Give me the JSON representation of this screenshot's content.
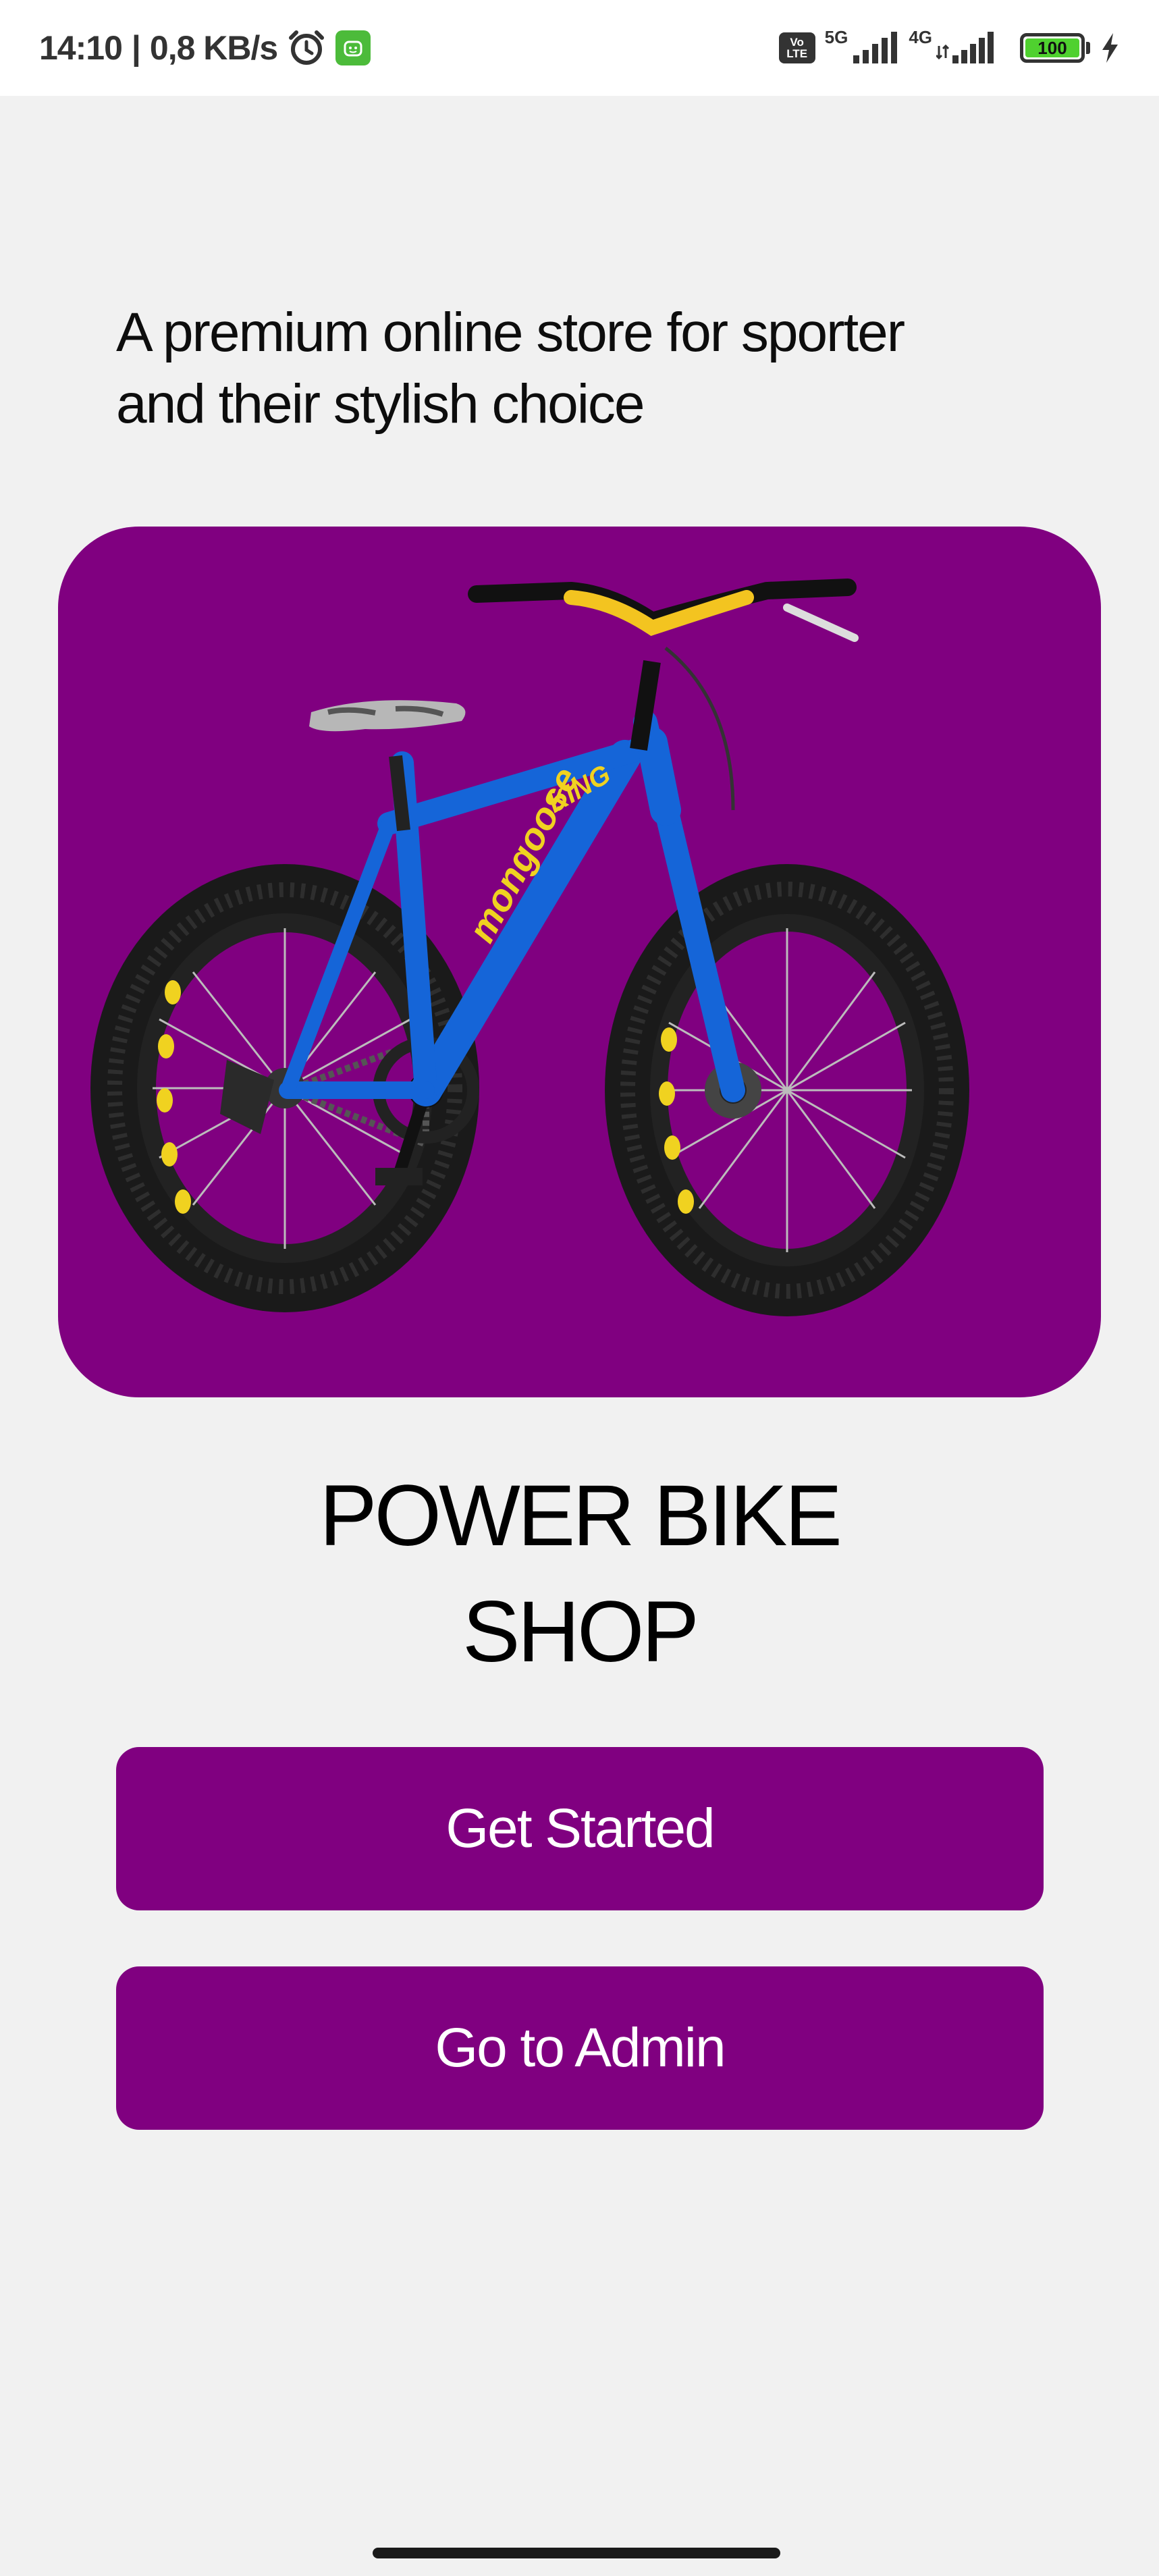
{
  "status_bar": {
    "time": "14:10",
    "separator": "|",
    "speed": "0,8 KB/s",
    "volte_line1": "Vo",
    "volte_line2": "LTE",
    "net1": "5G",
    "net2": "4G",
    "battery": "100",
    "icons": [
      "alarm-icon",
      "app-notification-icon",
      "signal-icon",
      "signal-icon",
      "battery-icon",
      "charging-icon"
    ]
  },
  "hero": {
    "tagline": "A premium online store for sporter and their stylish choice",
    "image": "fat-tire-bike-image",
    "image_text_1": "mongoose",
    "image_text_2": "KING",
    "card_color": "#800080"
  },
  "title": {
    "line1": "POWER BIKE",
    "line2": "SHOP"
  },
  "actions": {
    "get_started": "Get Started",
    "go_to_admin": "Go to Admin",
    "button_color": "#800080"
  }
}
